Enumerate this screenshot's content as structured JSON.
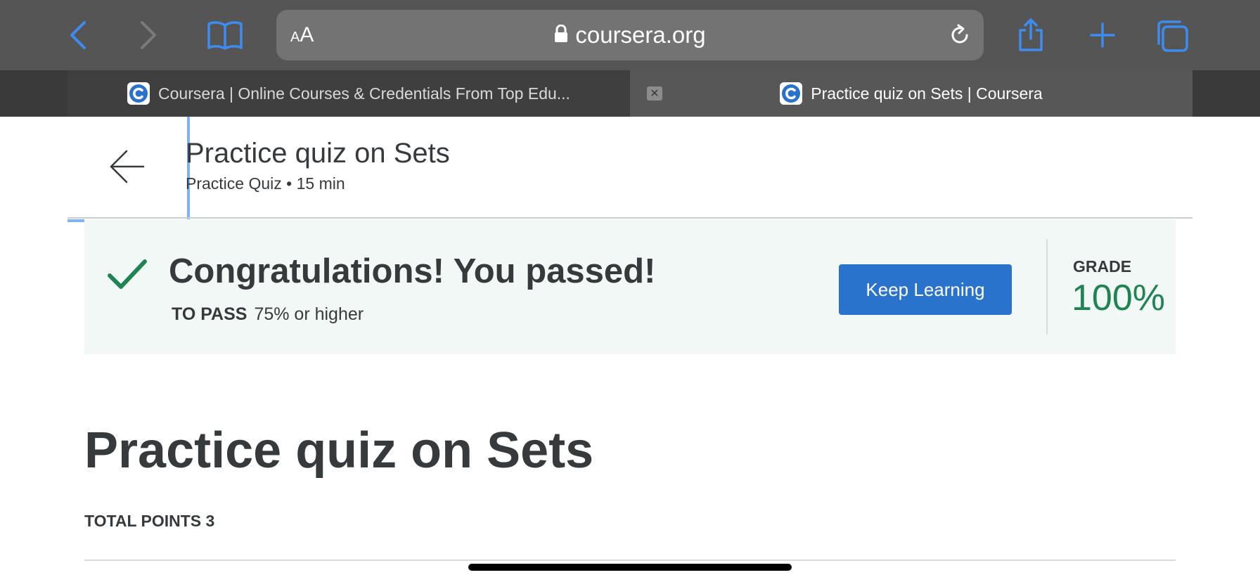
{
  "browser": {
    "text_size_label_small": "A",
    "text_size_label_large": "A",
    "url": "coursera.org",
    "accent_color": "#3d8cf0"
  },
  "tabs": [
    {
      "title": "Coursera | Online Courses & Credentials From Top Edu...",
      "active": false
    },
    {
      "title": "Practice quiz on Sets | Coursera",
      "active": true
    }
  ],
  "header": {
    "title": "Practice quiz on Sets",
    "subtitle": "Practice Quiz • 15 min"
  },
  "banner": {
    "message": "Congratulations! You passed!",
    "to_pass_label": "TO PASS",
    "to_pass_value": "75% or higher",
    "button_label": "Keep Learning",
    "grade_label": "GRADE",
    "grade_value": "100%",
    "success_color": "#1f8354"
  },
  "main": {
    "heading": "Practice quiz on Sets",
    "total_points": "TOTAL POINTS 3"
  }
}
